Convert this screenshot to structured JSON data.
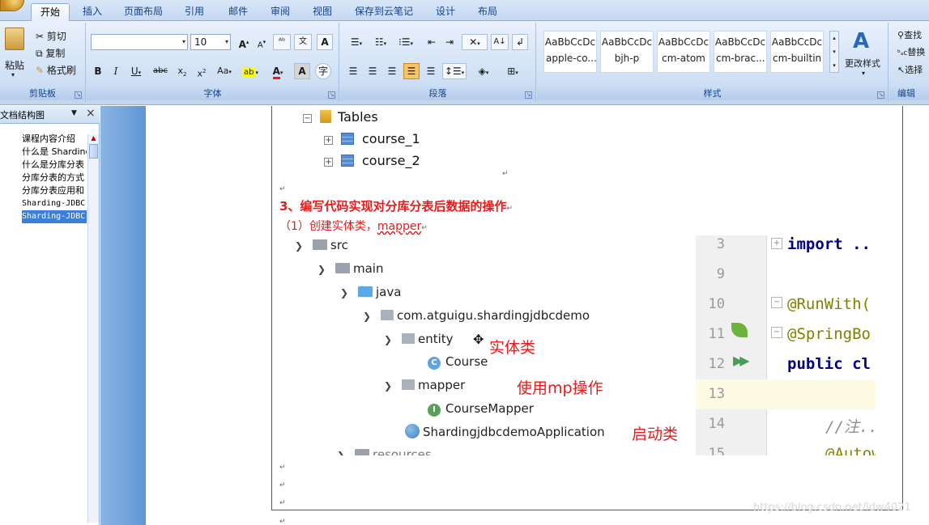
{
  "ribbon": {
    "tabs": [
      "开始",
      "插入",
      "页面布局",
      "引用",
      "邮件",
      "审阅",
      "视图",
      "保存到云笔记",
      "设计",
      "布局"
    ],
    "active_tab": "开始",
    "clipboard": {
      "paste": "粘贴",
      "cut": "剪切",
      "copy": "复制",
      "format_painter": "格式刷",
      "label": "剪贴板"
    },
    "font": {
      "font_name": "",
      "font_size": "10",
      "label": "字体"
    },
    "paragraph": {
      "label": "段落"
    },
    "styles": {
      "label": "样式",
      "change_styles": "更改样式",
      "gallery": [
        {
          "sample": "AaBbCcDc",
          "name": "apple-co..."
        },
        {
          "sample": "AaBbCcDc",
          "name": "bjh-p"
        },
        {
          "sample": "AaBbCcDc",
          "name": "cm-atom"
        },
        {
          "sample": "AaBbCcDc",
          "name": "cm-brac..."
        },
        {
          "sample": "AaBbCcDc",
          "name": "cm-builtin"
        }
      ]
    },
    "editing": {
      "find": "查找",
      "replace": "替换",
      "select": "选择",
      "label": "编辑"
    }
  },
  "nav_pane": {
    "title": "文档结构图",
    "items": [
      "课程内容介绍",
      "什么是 Sharding",
      "什么是分库分表",
      "分库分表的方式",
      "分库分表应用和",
      "Sharding-JDBC",
      "Sharding-JDBC"
    ],
    "selected_index": 6
  },
  "document": {
    "tables_tree": {
      "folder": "Tables",
      "tables": [
        "course_1",
        "course_2"
      ]
    },
    "heading": "3、编写代码实现对分库分表后数据的操作",
    "subheading_prefix": "（1）创建实体类，",
    "subheading_link": "mapper",
    "project_tree": {
      "src": "src",
      "main": "main",
      "java": "java",
      "package": "com.atguigu.shardingjdbcdemo",
      "entity": "entity",
      "course": "Course",
      "mapper": "mapper",
      "course_mapper": "CourseMapper",
      "app": "ShardingjdbcdemoApplication",
      "resources": "resources"
    },
    "annotations": {
      "entity": "实体类",
      "mapper": "使用mp操作",
      "app": "启动类"
    },
    "code": {
      "line_numbers": [
        "3",
        "9",
        "10",
        "11",
        "12",
        "13",
        "14",
        "15"
      ],
      "lines": [
        "import ..",
        "",
        "@RunWith(",
        "@SpringBo",
        "public cl",
        "",
        "//注...",
        "@Autow"
      ]
    }
  },
  "watermark": "https://blog.csdn.net/ldw4021"
}
